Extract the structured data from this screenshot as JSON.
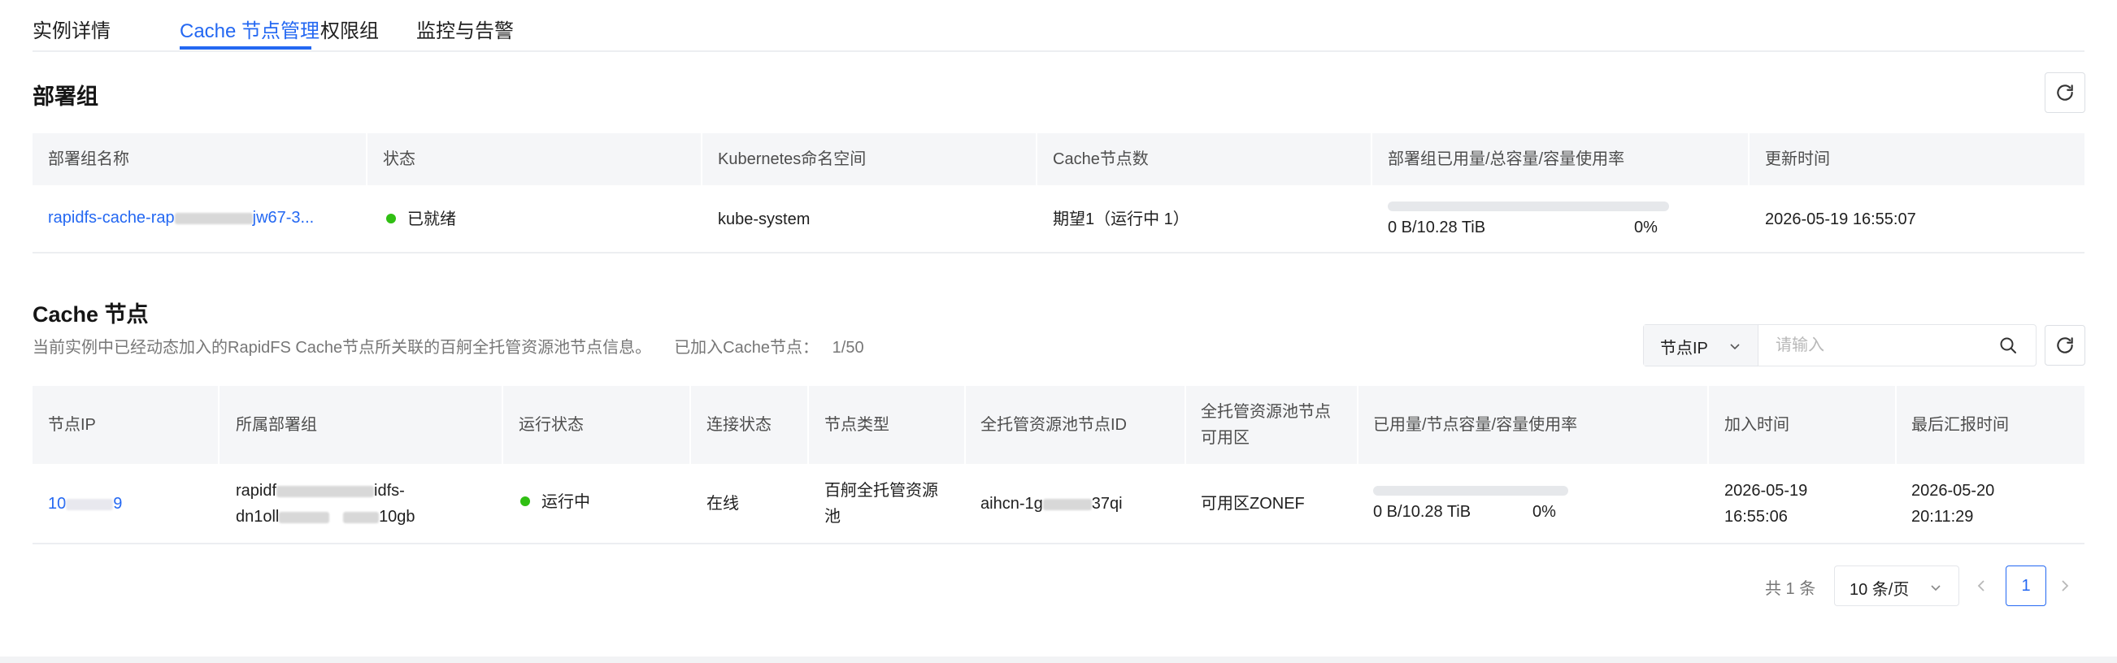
{
  "tabs": [
    {
      "label": "实例详情"
    },
    {
      "label": "Cache 节点管理"
    },
    {
      "label": "权限组"
    },
    {
      "label": "监控与告警"
    }
  ],
  "deploy_group": {
    "title": "部署组",
    "columns": [
      "部署组名称",
      "状态",
      "Kubernetes命名空间",
      "Cache节点数",
      "部署组已用量/总容量/容量使用率",
      "更新时间"
    ],
    "row": {
      "name_prefix": "rapidfs-cache-rap",
      "name_suffix": "jw67-3...",
      "status": "已就绪",
      "namespace": "kube-system",
      "node_count": "期望1（运行中 1）",
      "usage_text": "0 B/10.28 TiB",
      "usage_pct": "0%",
      "usage_fraction": 0,
      "updated": "2026-05-19 16:55:07"
    }
  },
  "cache_nodes": {
    "title": "Cache 节点",
    "description": "当前实例中已经动态加入的RapidFS Cache节点所关联的百舸全托管资源池节点信息。",
    "joined_label": "已加入Cache节点：",
    "joined_value": "1/50",
    "filter": {
      "select_label": "节点IP",
      "placeholder": "请输入"
    },
    "columns": [
      "节点IP",
      "所属部署组",
      "运行状态",
      "连接状态",
      "节点类型",
      "全托管资源池节点ID",
      "全托管资源池节点",
      "可用区",
      "已用量/节点容量/容量使用率",
      "加入时间",
      "最后汇报时间"
    ],
    "row": {
      "ip_prefix": "10",
      "ip_suffix": "9",
      "group_l1_prefix": "rapidf",
      "group_l1_suffix": "idfs-",
      "group_l2_prefix": "dn1oll",
      "group_l2_suffix": "10gb",
      "run_status": "运行中",
      "conn_status": "在线",
      "node_type_l1": "百舸全托管资源",
      "node_type_l2": "池",
      "pool_id_prefix": "aihcn-1g",
      "pool_id_suffix": "37qi",
      "zone": "可用区ZONEF",
      "usage_text": "0 B/10.28 TiB",
      "usage_pct": "0%",
      "usage_fraction": 0,
      "join_date": "2026-05-19",
      "join_time": "16:55:06",
      "report_date": "2026-05-20",
      "report_time": "20:11:29"
    }
  },
  "pagination": {
    "total": "共 1 条",
    "page_size": "10 条/页",
    "current_page": "1"
  },
  "icons": {
    "refresh": "refresh-icon",
    "search": "search-icon",
    "chevron_down": "chevron-down-icon",
    "chevron_left": "chevron-left-icon",
    "chevron_right": "chevron-right-icon"
  },
  "colors": {
    "accent": "#2468f2",
    "status_green": "#30bf13",
    "header_bg": "#f5f6f8"
  }
}
